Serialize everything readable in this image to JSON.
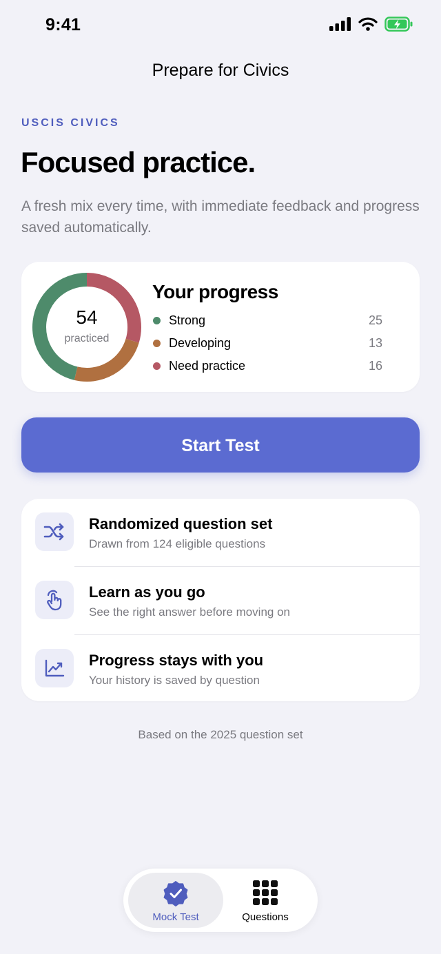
{
  "status_bar": {
    "time": "9:41"
  },
  "nav": {
    "title": "Prepare for Civics"
  },
  "hero": {
    "eyebrow": "USCIS CIVICS",
    "headline": "Focused practice.",
    "subtitle": "A fresh mix every time, with immediate feedback and progress saved automatically."
  },
  "progress": {
    "title": "Your progress",
    "total": "54",
    "total_label": "practiced",
    "items": [
      {
        "label": "Strong",
        "value": "25",
        "color": "#4E8B6B"
      },
      {
        "label": "Developing",
        "value": "13",
        "color": "#B07040"
      },
      {
        "label": "Need practice",
        "value": "16",
        "color": "#B55864"
      }
    ]
  },
  "start_button": {
    "label": "Start Test",
    "color": "#5B6BD1"
  },
  "features": [
    {
      "icon": "shuffle-icon",
      "title": "Randomized question set",
      "subtitle": "Drawn from 124 eligible questions"
    },
    {
      "icon": "hand-tap-icon",
      "title": "Learn as you go",
      "subtitle": "See the right answer before moving on"
    },
    {
      "icon": "trend-chart-icon",
      "title": "Progress stays with you",
      "subtitle": "Your history is saved by question"
    }
  ],
  "footnote": "Based on the 2025 question set",
  "tab_bar": {
    "tabs": [
      {
        "label": "Mock Test",
        "icon": "check-badge-icon",
        "selected": true
      },
      {
        "label": "Questions",
        "icon": "grid-icon",
        "selected": false
      }
    ]
  },
  "colors": {
    "accent": "#5B6BD1",
    "background": "#F2F2F8"
  }
}
